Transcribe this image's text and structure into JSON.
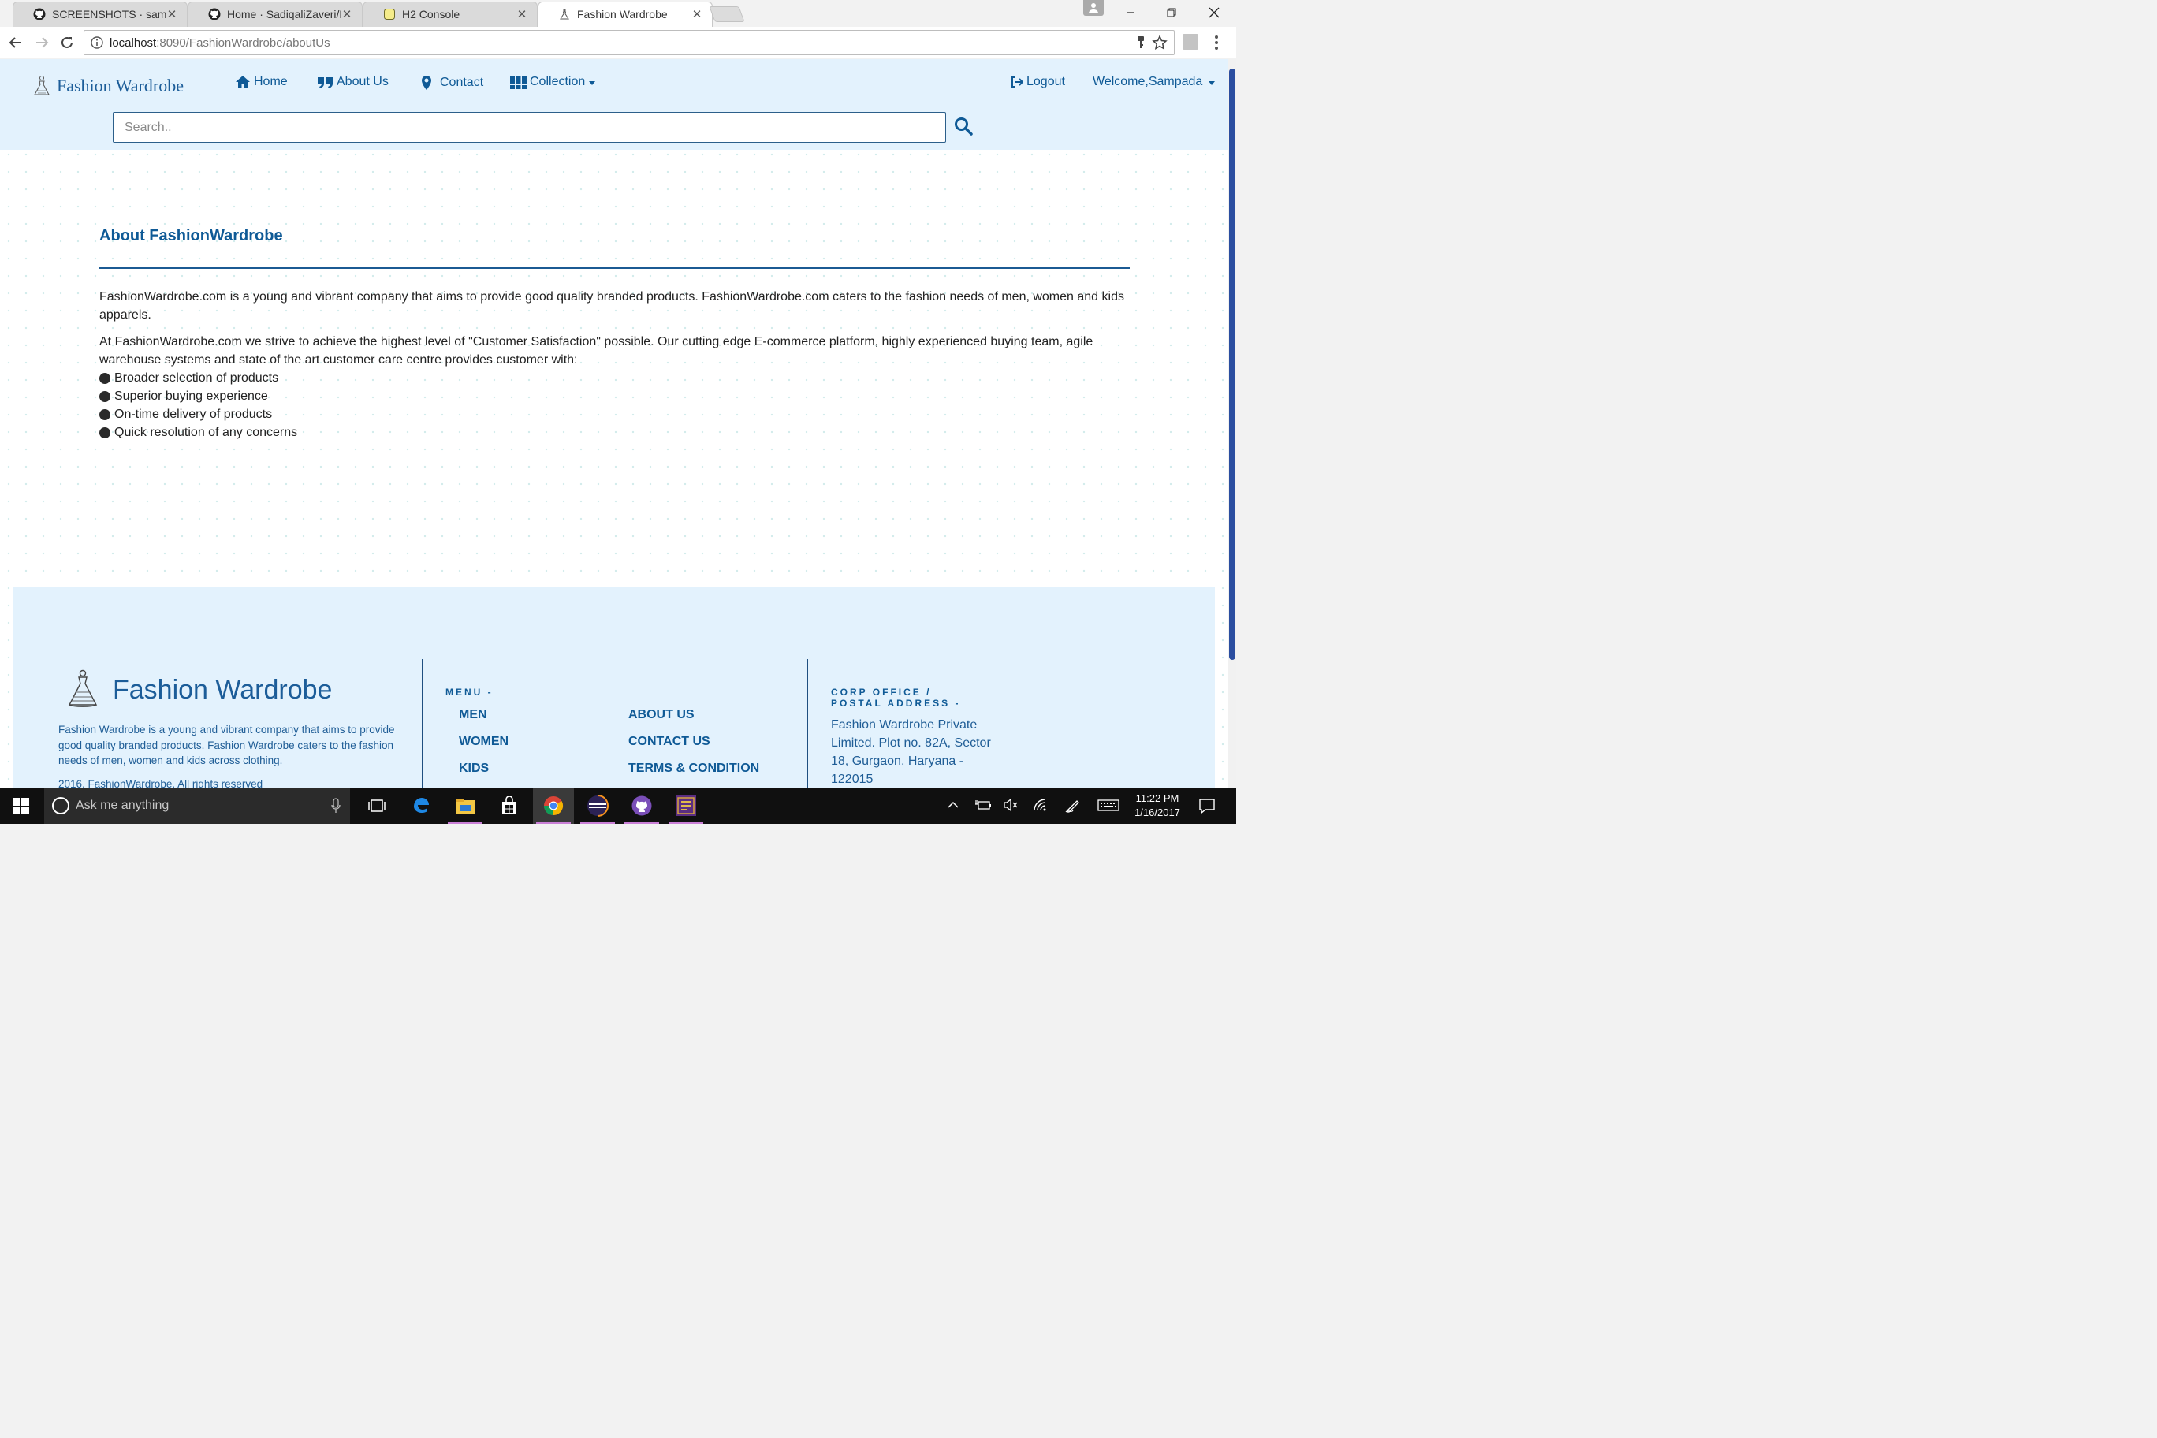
{
  "browser": {
    "tabs": [
      {
        "title": "SCREENSHOTS · sampda",
        "icon": "github-icon",
        "active": false
      },
      {
        "title": "Home · SadiqaliZaveri/M",
        "icon": "github-icon",
        "active": false
      },
      {
        "title": "H2 Console",
        "icon": "h2-icon",
        "active": false
      },
      {
        "title": "Fashion Wardrobe",
        "icon": "dress-icon",
        "active": true
      }
    ],
    "url_host": "localhost",
    "url_path": ":8090/FashionWardrobe/aboutUs"
  },
  "site": {
    "brand": "Fashion Wardrobe",
    "nav": {
      "home": "Home",
      "about": "About Us",
      "contact": "Contact",
      "collection": "Collection",
      "logout": "Logout",
      "welcome": "Welcome,Sampada"
    },
    "search": {
      "placeholder": "Search.."
    }
  },
  "about": {
    "title": "About FashionWardrobe",
    "para1": "FashionWardrobe.com is a young and vibrant company that aims to provide good quality branded products. FashionWardrobe.com caters to the fashion needs of men, women and kids apparels.",
    "para2": "At FashionWardrobe.com we strive to achieve the highest level of \"Customer Satisfaction\" possible. Our cutting edge E-commerce platform, highly experienced buying team, agile warehouse systems and state of the art customer care centre provides customer with:",
    "bullets": [
      "Broader selection of products",
      "Superior buying experience",
      "On-time delivery of products",
      "Quick resolution of any concerns"
    ]
  },
  "footer": {
    "brand": "Fashion Wardrobe",
    "description": "Fashion Wardrobe is a young and vibrant company that aims to provide good quality branded products. Fashion Wardrobe caters to the fashion needs of men, women and kids across clothing.",
    "copyright": "2016, FashionWardrobe. All rights reserved",
    "menu_heading": "MENU -",
    "menu_col1": [
      "MEN",
      "WOMEN",
      "KIDS"
    ],
    "menu_col2": [
      "ABOUT US",
      "CONTACT US",
      "TERMS & CONDITION"
    ],
    "office_heading_line1": "CORP OFFICE /",
    "office_heading_line2": "POSTAL ADDRESS -",
    "address": "Fashion Wardrobe Private Limited. Plot no. 82A, Sector 18, Gurgaon, Haryana - 122015"
  },
  "taskbar": {
    "search_text": "Ask me anything",
    "time": "11:22 PM",
    "date": "1/16/2017"
  },
  "colors": {
    "accent": "#0f5a96",
    "nav_bg": "#e3f2fd",
    "scroll_thumb": "#2b4ea0"
  }
}
